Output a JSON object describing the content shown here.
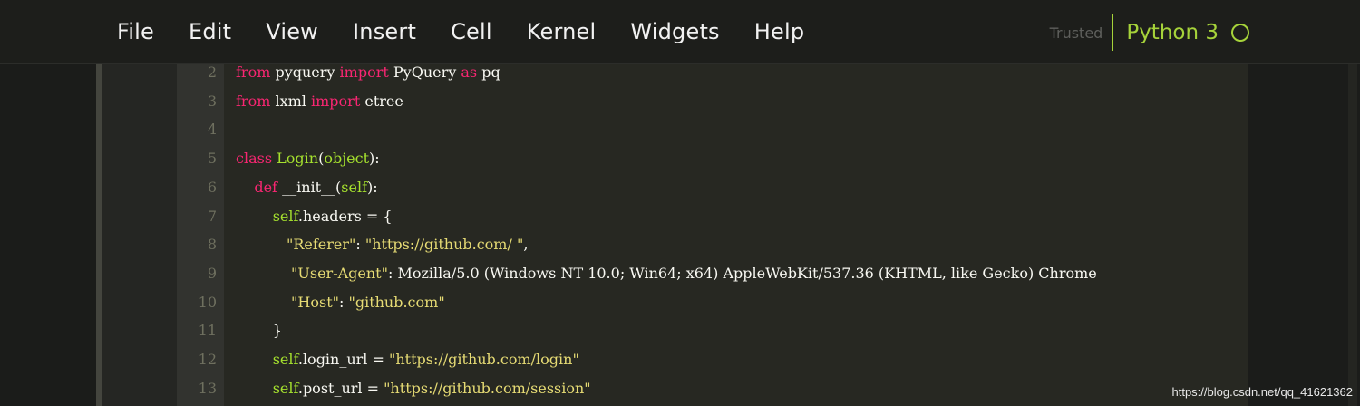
{
  "menu": {
    "items": [
      "File",
      "Edit",
      "View",
      "Insert",
      "Cell",
      "Kernel",
      "Widgets",
      "Help"
    ]
  },
  "kernel": {
    "trusted": "Trusted",
    "name": "Python 3",
    "status_icon": "kernel-idle-circle-icon"
  },
  "code": {
    "lines": [
      {
        "num": "2",
        "text": "from pyquery import PyQuery as pq"
      },
      {
        "num": "3",
        "text": "from lxml import etree"
      },
      {
        "num": "4",
        "text": ""
      },
      {
        "num": "5",
        "text": "class Login(object):"
      },
      {
        "num": "6",
        "text": "    def __init__(self):"
      },
      {
        "num": "7",
        "text": "        self.headers = {"
      },
      {
        "num": "8",
        "text": "           \"Referer\": \"https://github.com/ \","
      },
      {
        "num": "9",
        "text": "            \"User-Agent\": \"Mozilla/5.0 (Windows NT 10.0; Win64; x64) AppleWebKit/537.36 (KHTML, like Gecko) Chrome"
      },
      {
        "num": "10",
        "text": "            \"Host\": \"github.com\""
      },
      {
        "num": "11",
        "text": "        }"
      },
      {
        "num": "12",
        "text": "        self.login_url = \"https://github.com/login\""
      },
      {
        "num": "13",
        "text": "        self.post_url = \"https://github.com/session\""
      }
    ]
  },
  "colors": {
    "kernel_accent": "#a6d33a",
    "keyword": "#f92672",
    "builtin": "#a6e22e",
    "string": "#e6db74",
    "code_bg": "#272822"
  },
  "watermark": "https://blog.csdn.net/qq_41621362"
}
